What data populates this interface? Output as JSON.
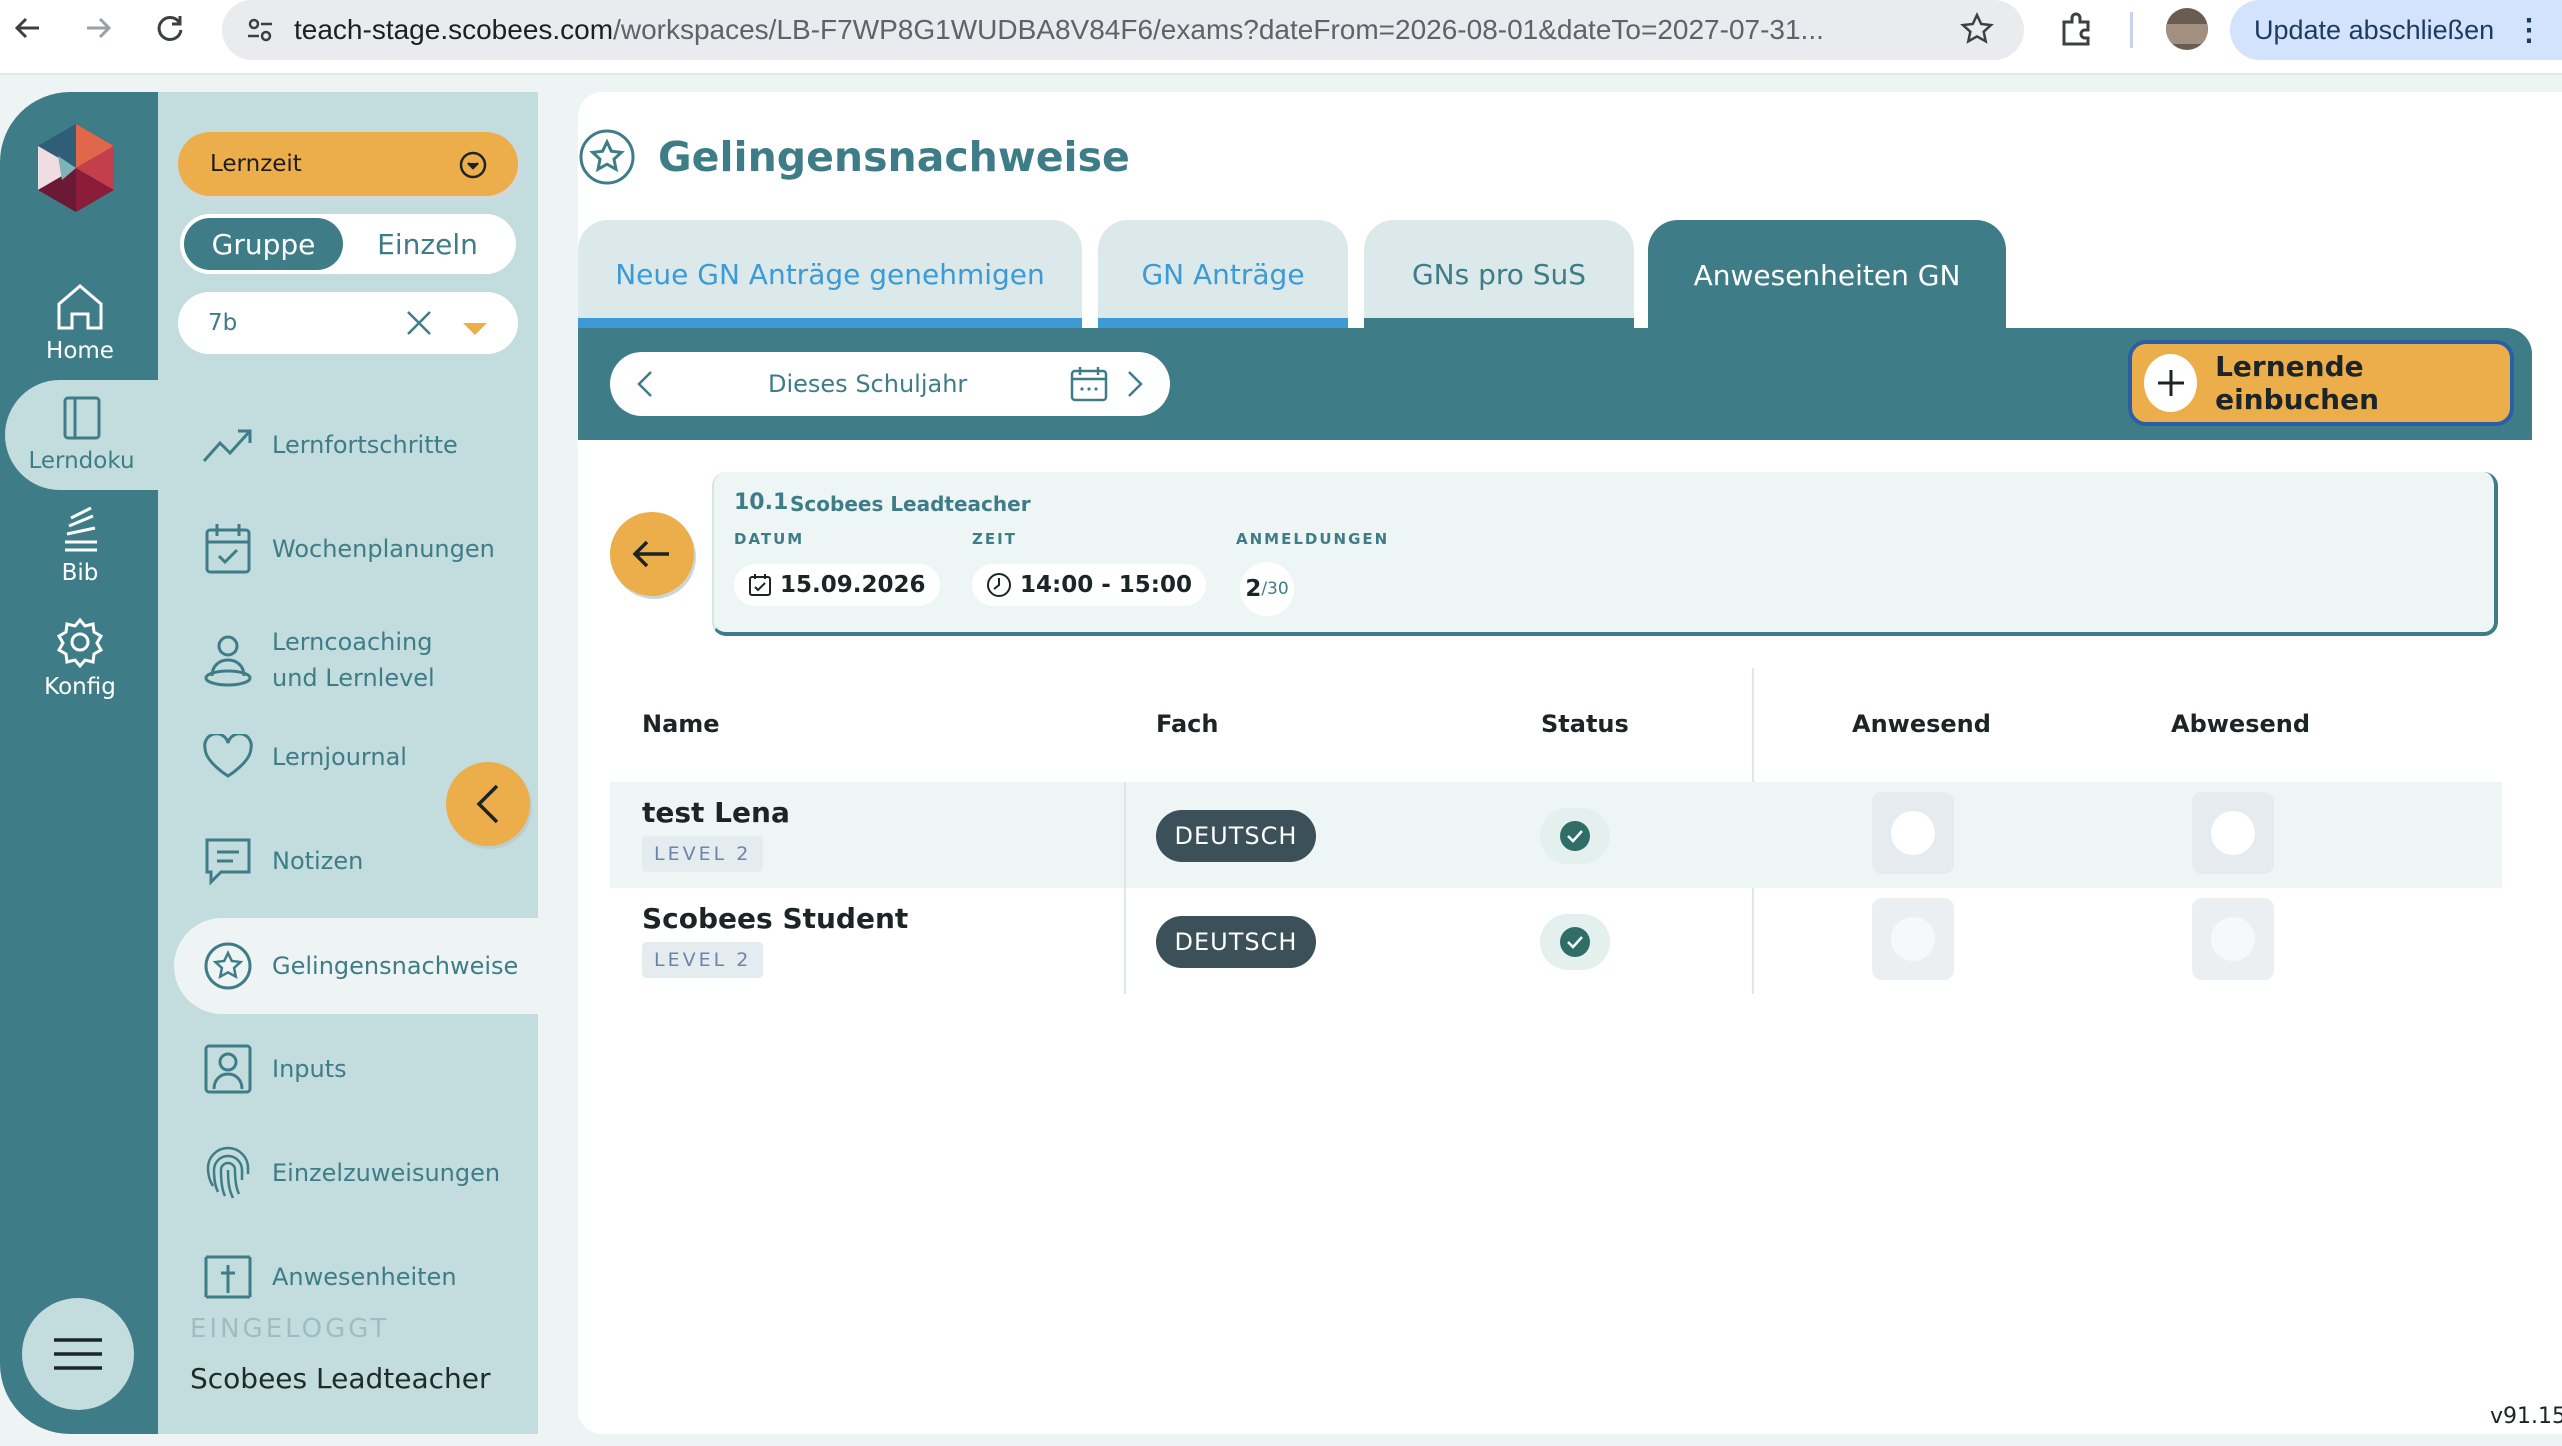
{
  "browser": {
    "url_host": "teach-stage.scobees.com",
    "url_path": "/workspaces/LB-F7WP8G1WUDBA8V84F6/exams?dateFrom=2026-08-01&dateTo=2027-07-31...",
    "update_label": "Update abschließen"
  },
  "rail": {
    "items": [
      {
        "label": "Home",
        "icon": "home-icon"
      },
      {
        "label": "Lerndoku",
        "icon": "notebook-icon"
      },
      {
        "label": "Bib",
        "icon": "library-icon"
      },
      {
        "label": "Konfig",
        "icon": "gear-icon"
      }
    ]
  },
  "panel": {
    "mode_label": "Lernzeit",
    "toggle": {
      "group": "Gruppe",
      "single": "Einzeln"
    },
    "class_value": "7b",
    "menu": [
      {
        "label": "Lernfortschritte",
        "icon": "trend-icon"
      },
      {
        "label": "Wochenplanungen",
        "icon": "calendar-check-icon"
      },
      {
        "label": "Lerncoaching",
        "label2": "und Lernlevel",
        "icon": "coaching-icon"
      },
      {
        "label": "Lernjournal",
        "icon": "heart-icon"
      },
      {
        "label": "Notizen",
        "icon": "note-icon"
      },
      {
        "label": "Gelingensnachweise",
        "icon": "star-badge-icon"
      },
      {
        "label": "Inputs",
        "icon": "person-frame-icon"
      },
      {
        "label": "Einzelzuweisungen",
        "icon": "fingerprint-icon"
      },
      {
        "label": "Anwesenheiten",
        "icon": "attendance-icon"
      }
    ],
    "logged_in_label": "EINGELOGGT",
    "logged_in_user": "Scobees Leadteacher"
  },
  "page": {
    "title": "Gelingensnachweise",
    "tabs": [
      {
        "label": "Neue GN Anträge genehmigen"
      },
      {
        "label": "GN Anträge"
      },
      {
        "label": "GNs pro SuS"
      },
      {
        "label": "Anwesenheiten GN"
      }
    ],
    "period_label": "Dieses Schuljahr",
    "book_button": "Lernende einbuchen"
  },
  "exam": {
    "code": "10.1",
    "teacher": "Scobees Leadteacher",
    "date_label": "DATUM",
    "date": "15.09.2026",
    "time_label": "ZEIT",
    "time": "14:00 - 15:00",
    "registrations_label": "ANMELDUNGEN",
    "registered": "2",
    "capacity": "/30"
  },
  "table": {
    "headers": {
      "name": "Name",
      "subject": "Fach",
      "status": "Status",
      "present": "Anwesend",
      "absent": "Abwesend"
    },
    "rows": [
      {
        "name": "test Lena",
        "level": "LEVEL 2",
        "subject": "DEUTSCH",
        "status": "confirmed"
      },
      {
        "name": "Scobees Student",
        "level": "LEVEL 2",
        "subject": "DEUTSCH",
        "status": "confirmed"
      }
    ]
  },
  "version": "v91.15",
  "colors": {
    "teal": "#3e7d88",
    "orange": "#ecad4b",
    "blue": "#3e9ad4"
  }
}
